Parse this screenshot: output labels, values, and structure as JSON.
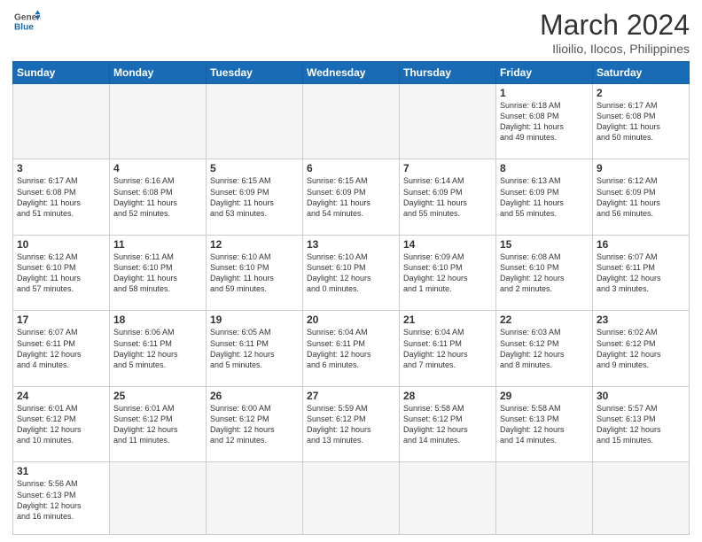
{
  "logo": {
    "line1": "General",
    "line2": "Blue"
  },
  "title": "March 2024",
  "location": "Ilioilio, Ilocos, Philippines",
  "days_of_week": [
    "Sunday",
    "Monday",
    "Tuesday",
    "Wednesday",
    "Thursday",
    "Friday",
    "Saturday"
  ],
  "weeks": [
    [
      {
        "day": "",
        "info": ""
      },
      {
        "day": "",
        "info": ""
      },
      {
        "day": "",
        "info": ""
      },
      {
        "day": "",
        "info": ""
      },
      {
        "day": "",
        "info": ""
      },
      {
        "day": "1",
        "info": "Sunrise: 6:18 AM\nSunset: 6:08 PM\nDaylight: 11 hours\nand 49 minutes."
      },
      {
        "day": "2",
        "info": "Sunrise: 6:17 AM\nSunset: 6:08 PM\nDaylight: 11 hours\nand 50 minutes."
      }
    ],
    [
      {
        "day": "3",
        "info": "Sunrise: 6:17 AM\nSunset: 6:08 PM\nDaylight: 11 hours\nand 51 minutes."
      },
      {
        "day": "4",
        "info": "Sunrise: 6:16 AM\nSunset: 6:08 PM\nDaylight: 11 hours\nand 52 minutes."
      },
      {
        "day": "5",
        "info": "Sunrise: 6:15 AM\nSunset: 6:09 PM\nDaylight: 11 hours\nand 53 minutes."
      },
      {
        "day": "6",
        "info": "Sunrise: 6:15 AM\nSunset: 6:09 PM\nDaylight: 11 hours\nand 54 minutes."
      },
      {
        "day": "7",
        "info": "Sunrise: 6:14 AM\nSunset: 6:09 PM\nDaylight: 11 hours\nand 55 minutes."
      },
      {
        "day": "8",
        "info": "Sunrise: 6:13 AM\nSunset: 6:09 PM\nDaylight: 11 hours\nand 55 minutes."
      },
      {
        "day": "9",
        "info": "Sunrise: 6:12 AM\nSunset: 6:09 PM\nDaylight: 11 hours\nand 56 minutes."
      }
    ],
    [
      {
        "day": "10",
        "info": "Sunrise: 6:12 AM\nSunset: 6:10 PM\nDaylight: 11 hours\nand 57 minutes."
      },
      {
        "day": "11",
        "info": "Sunrise: 6:11 AM\nSunset: 6:10 PM\nDaylight: 11 hours\nand 58 minutes."
      },
      {
        "day": "12",
        "info": "Sunrise: 6:10 AM\nSunset: 6:10 PM\nDaylight: 11 hours\nand 59 minutes."
      },
      {
        "day": "13",
        "info": "Sunrise: 6:10 AM\nSunset: 6:10 PM\nDaylight: 12 hours\nand 0 minutes."
      },
      {
        "day": "14",
        "info": "Sunrise: 6:09 AM\nSunset: 6:10 PM\nDaylight: 12 hours\nand 1 minute."
      },
      {
        "day": "15",
        "info": "Sunrise: 6:08 AM\nSunset: 6:10 PM\nDaylight: 12 hours\nand 2 minutes."
      },
      {
        "day": "16",
        "info": "Sunrise: 6:07 AM\nSunset: 6:11 PM\nDaylight: 12 hours\nand 3 minutes."
      }
    ],
    [
      {
        "day": "17",
        "info": "Sunrise: 6:07 AM\nSunset: 6:11 PM\nDaylight: 12 hours\nand 4 minutes."
      },
      {
        "day": "18",
        "info": "Sunrise: 6:06 AM\nSunset: 6:11 PM\nDaylight: 12 hours\nand 5 minutes."
      },
      {
        "day": "19",
        "info": "Sunrise: 6:05 AM\nSunset: 6:11 PM\nDaylight: 12 hours\nand 5 minutes."
      },
      {
        "day": "20",
        "info": "Sunrise: 6:04 AM\nSunset: 6:11 PM\nDaylight: 12 hours\nand 6 minutes."
      },
      {
        "day": "21",
        "info": "Sunrise: 6:04 AM\nSunset: 6:11 PM\nDaylight: 12 hours\nand 7 minutes."
      },
      {
        "day": "22",
        "info": "Sunrise: 6:03 AM\nSunset: 6:12 PM\nDaylight: 12 hours\nand 8 minutes."
      },
      {
        "day": "23",
        "info": "Sunrise: 6:02 AM\nSunset: 6:12 PM\nDaylight: 12 hours\nand 9 minutes."
      }
    ],
    [
      {
        "day": "24",
        "info": "Sunrise: 6:01 AM\nSunset: 6:12 PM\nDaylight: 12 hours\nand 10 minutes."
      },
      {
        "day": "25",
        "info": "Sunrise: 6:01 AM\nSunset: 6:12 PM\nDaylight: 12 hours\nand 11 minutes."
      },
      {
        "day": "26",
        "info": "Sunrise: 6:00 AM\nSunset: 6:12 PM\nDaylight: 12 hours\nand 12 minutes."
      },
      {
        "day": "27",
        "info": "Sunrise: 5:59 AM\nSunset: 6:12 PM\nDaylight: 12 hours\nand 13 minutes."
      },
      {
        "day": "28",
        "info": "Sunrise: 5:58 AM\nSunset: 6:12 PM\nDaylight: 12 hours\nand 14 minutes."
      },
      {
        "day": "29",
        "info": "Sunrise: 5:58 AM\nSunset: 6:13 PM\nDaylight: 12 hours\nand 14 minutes."
      },
      {
        "day": "30",
        "info": "Sunrise: 5:57 AM\nSunset: 6:13 PM\nDaylight: 12 hours\nand 15 minutes."
      }
    ],
    [
      {
        "day": "31",
        "info": "Sunrise: 5:56 AM\nSunset: 6:13 PM\nDaylight: 12 hours\nand 16 minutes."
      },
      {
        "day": "",
        "info": ""
      },
      {
        "day": "",
        "info": ""
      },
      {
        "day": "",
        "info": ""
      },
      {
        "day": "",
        "info": ""
      },
      {
        "day": "",
        "info": ""
      },
      {
        "day": "",
        "info": ""
      }
    ]
  ]
}
